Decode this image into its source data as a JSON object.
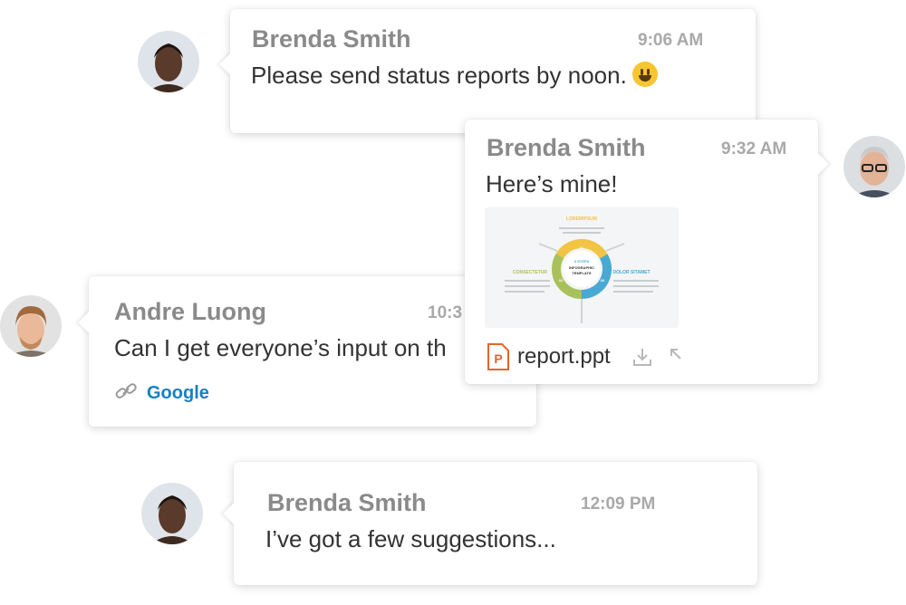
{
  "messages": [
    {
      "sender": "Brenda Smith",
      "time": "9:06 AM",
      "text": "Please send status reports by noon.",
      "emoji": "grinning-face-emoji"
    },
    {
      "sender": "Brenda Smith",
      "time": "9:32 AM",
      "text": "Here’s mine!",
      "attachment": {
        "file_name": "report.ppt",
        "file_icon_letter": "P",
        "thumbnail": {
          "top_label": "LOREMIPSUM",
          "center_title": "3 STEPS",
          "center_subtitle": "INFOGRAPHIC",
          "center_subtitle2": "TEMPLATE",
          "left_label": "CONSECTETUR",
          "right_label": "DOLOR SITAMET",
          "left_num": "03",
          "right_num": "02",
          "top_num": "01"
        },
        "download_icon": "download-icon",
        "open_icon": "open-arrow-icon"
      }
    },
    {
      "sender": "Andre Luong",
      "time": "10:3",
      "text": "Can I get everyone’s input on th",
      "link_label": "Google",
      "link_icon": "link-icon"
    },
    {
      "sender": "Brenda Smith",
      "time": "12:09 PM",
      "text": "I’ve got a few suggestions..."
    }
  ],
  "colors": {
    "sender": "#8a8a8a",
    "time": "#a9a9a9",
    "link": "#1a7fc1",
    "file_icon": "#e8632b",
    "chart_yellow": "#f2c443",
    "chart_green": "#a9c15b",
    "chart_blue": "#49a9d3"
  }
}
